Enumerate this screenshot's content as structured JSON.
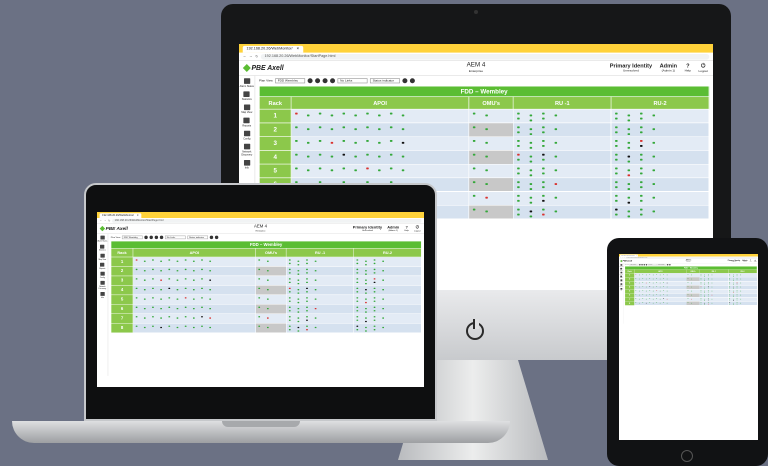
{
  "browser": {
    "tab_title": "192.168.20.26/WebMonitor/",
    "url": "192.168.20.26/WebMonitor/StartPage.html"
  },
  "app": {
    "logo": "PBE Axell",
    "title": "AEM 4",
    "subtitle": "Enterprise",
    "header_right": [
      {
        "label": "Primary Identity",
        "value": "Unresolved"
      },
      {
        "label": "Admin",
        "value": "(Admin 1)"
      },
      {
        "label": "Help",
        "value": "?"
      },
      {
        "label": "Logout",
        "value": "⏻"
      }
    ]
  },
  "sidebar": {
    "items": [
      {
        "label": "Alarm Status"
      },
      {
        "label": "Statistics"
      },
      {
        "label": "Map View"
      },
      {
        "label": "Reports"
      },
      {
        "label": "Config"
      },
      {
        "label": "Network Discovery"
      },
      {
        "label": "Info"
      }
    ]
  },
  "toolbar": {
    "view_label": "Plan View",
    "view_value": "FDD Wembley",
    "level_value": "No Links",
    "status_value": "Status indicator"
  },
  "rack": {
    "title": "FDD – Wembley",
    "columns": [
      "Rack",
      "APOI",
      "OMU's",
      "RU -1",
      "RU-2"
    ],
    "rows": [
      "1",
      "2",
      "3",
      "4",
      "5",
      "6",
      "7",
      "8"
    ],
    "apoi_slots_row1": [
      "1",
      "2",
      "3",
      "4",
      "5",
      "6",
      "7"
    ],
    "apoi_slots_row2": [
      "8",
      "9",
      "10",
      "11",
      "12",
      "13",
      "14"
    ]
  },
  "colors": {
    "accent": "#5bbd33",
    "header_green": "#8cc84b",
    "browser_yellow": "#ffd23a",
    "led_ok": "#34a83a",
    "led_alarm": "#d9322f",
    "led_off": "#111111"
  }
}
